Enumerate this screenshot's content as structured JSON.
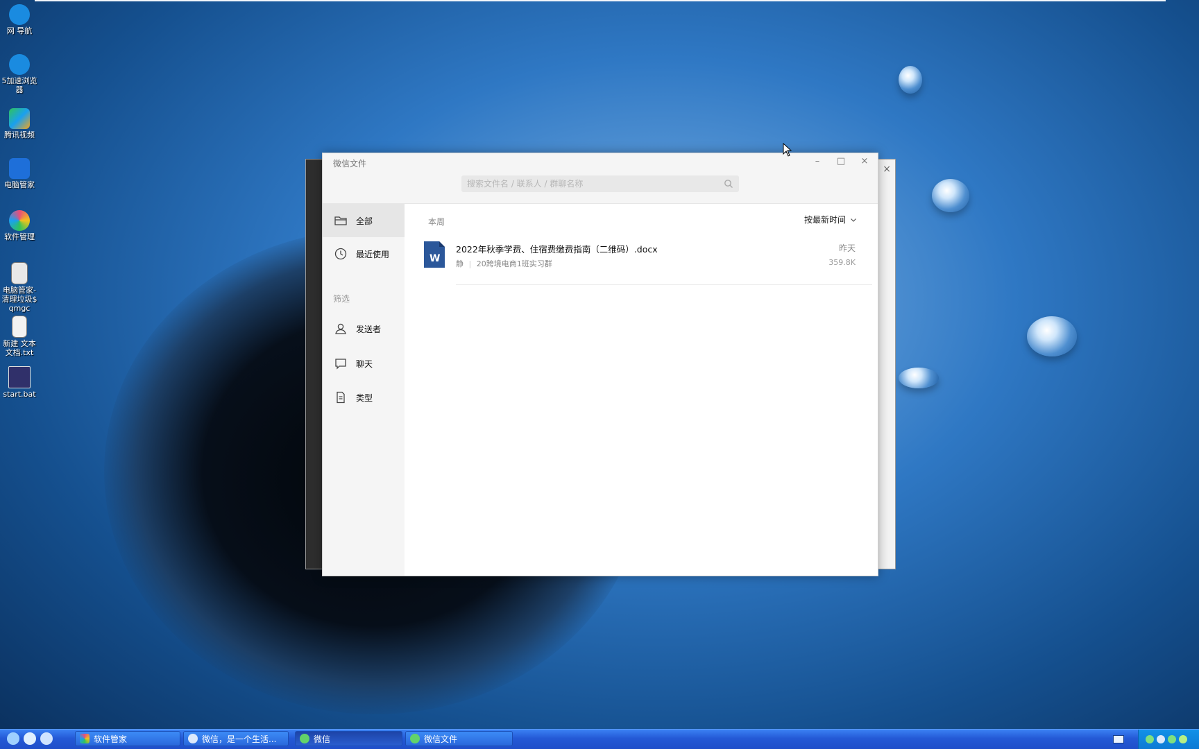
{
  "desktop": {
    "icons": [
      {
        "label": "网 导航",
        "color": "#1a8be0"
      },
      {
        "label": "5加速浏览器",
        "color": "#1a8be0"
      },
      {
        "label": "腾讯视频",
        "color": "#2fc35a"
      },
      {
        "label": "电脑管家",
        "color": "#1e6fd9"
      },
      {
        "label": "软件管理",
        "color": "#e94d7a"
      },
      {
        "label": "电脑管家-清理垃圾$ qmgc",
        "color": "#e8e8e8"
      },
      {
        "label": "新建 文本文档.txt",
        "color": "#f2f2f2"
      },
      {
        "label": "start.bat",
        "color": "#30306a"
      }
    ]
  },
  "window": {
    "title": "微信文件",
    "minimize_label": "–",
    "maximize_label": "□",
    "close_label": "×",
    "search_placeholder": "搜索文件名 / 联系人 / 群聊名称"
  },
  "sidebar": {
    "items": [
      {
        "label": "全部",
        "icon": "folder-icon"
      },
      {
        "label": "最近使用",
        "icon": "clock-icon"
      }
    ],
    "filter_label": "筛选",
    "filters": [
      {
        "label": "发送者",
        "icon": "person-icon"
      },
      {
        "label": "聊天",
        "icon": "chat-icon"
      },
      {
        "label": "类型",
        "icon": "document-icon"
      }
    ]
  },
  "content": {
    "section_label": "本周",
    "sort_label": "按最新时间",
    "files": [
      {
        "name": "2022年秋季学费、住宿费缴费指南（二维码）.docx",
        "sender": "静",
        "chat": "20跨境电商1班实习群",
        "date": "昨天",
        "size": "359.8K",
        "icon_letter": "W"
      }
    ]
  },
  "bg_window": {
    "close_label": "×"
  },
  "taskbar": {
    "tasks": [
      {
        "label": "软件管家"
      },
      {
        "label": "微信，是一个生活..."
      },
      {
        "label": "微信"
      },
      {
        "label": "微信文件"
      }
    ]
  }
}
